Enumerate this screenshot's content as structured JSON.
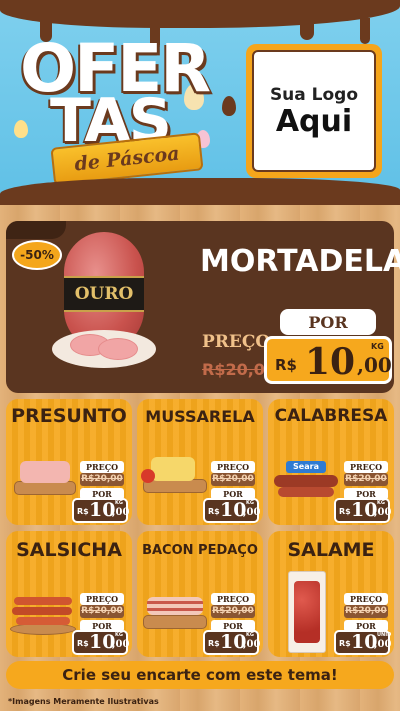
{
  "header": {
    "title_line1": "OFER",
    "title_line2": "TAS",
    "subtitle": "de Páscoa",
    "logo_line1": "Sua Logo",
    "logo_line2": "Aqui"
  },
  "featured": {
    "name": "MORTADELA",
    "discount_badge": "-50%",
    "brand": "OURO",
    "old_label": "PREÇO",
    "old_price": "R$20,00",
    "new_label": "POR",
    "currency": "R$",
    "price_int": "10",
    "price_cents": ",00",
    "unit": "KG"
  },
  "products": [
    {
      "name": "PRESUNTO",
      "old_label": "PREÇO",
      "old_price": "R$20,00",
      "new_label": "POR",
      "currency": "R$",
      "price_int": "10",
      "price_cents": ",00",
      "unit": "KG"
    },
    {
      "name": "MUSSARELA",
      "old_label": "PREÇO",
      "old_price": "R$20,00",
      "new_label": "POR",
      "currency": "R$",
      "price_int": "10",
      "price_cents": ",00",
      "unit": "KG"
    },
    {
      "name": "CALABRESA",
      "old_label": "PREÇO",
      "old_price": "R$20,00",
      "new_label": "POR",
      "currency": "R$",
      "price_int": "10",
      "price_cents": ",00",
      "unit": "KG",
      "brand": "Seara"
    },
    {
      "name": "SALSICHA",
      "old_label": "PREÇO",
      "old_price": "R$20,00",
      "new_label": "POR",
      "currency": "R$",
      "price_int": "10",
      "price_cents": ",00",
      "unit": "KG"
    },
    {
      "name": "BACON PEDAÇO",
      "old_label": "PREÇO",
      "old_price": "R$20,00",
      "new_label": "POR",
      "currency": "R$",
      "price_int": "10",
      "price_cents": ",00",
      "unit": "KG"
    },
    {
      "name": "SALAME",
      "old_label": "PREÇO",
      "old_price": "R$20,00",
      "new_label": "POR",
      "currency": "R$",
      "price_int": "10",
      "price_cents": ",00",
      "unit": "UNID"
    }
  ],
  "footer": {
    "cta": "Crie seu encarte com este tema!",
    "note": "*Imagens Meramente Ilustrativas"
  },
  "colors": {
    "sky": "#7fd0ee",
    "chocolate": "#6b3a1e",
    "orange": "#f6a81d",
    "dark_brown": "#5a3520"
  }
}
